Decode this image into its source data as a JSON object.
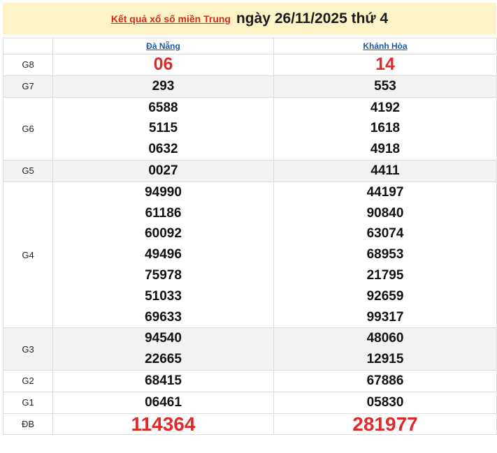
{
  "header": {
    "link_text": "Kết quả xổ số miền Trung",
    "date_text": "ngày 26/11/2025 thứ 4"
  },
  "provinces": [
    "Đà Nẵng",
    "Khánh Hòa"
  ],
  "rows": [
    {
      "label": "G8",
      "style": "red",
      "shade": "white",
      "values": [
        [
          "06"
        ],
        [
          "14"
        ]
      ]
    },
    {
      "label": "G7",
      "style": "",
      "shade": "alt",
      "values": [
        [
          "293"
        ],
        [
          "553"
        ]
      ]
    },
    {
      "label": "G6",
      "style": "",
      "shade": "white",
      "values": [
        [
          "6588",
          "5115",
          "0632"
        ],
        [
          "4192",
          "1618",
          "4918"
        ]
      ]
    },
    {
      "label": "G5",
      "style": "",
      "shade": "alt",
      "values": [
        [
          "0027"
        ],
        [
          "4411"
        ]
      ]
    },
    {
      "label": "G4",
      "style": "",
      "shade": "white",
      "values": [
        [
          "94990",
          "61186",
          "60092",
          "49496",
          "75978",
          "51033",
          "69633"
        ],
        [
          "44197",
          "90840",
          "63074",
          "68953",
          "21795",
          "92659",
          "99317"
        ]
      ]
    },
    {
      "label": "G3",
      "style": "",
      "shade": "alt",
      "values": [
        [
          "94540",
          "22665"
        ],
        [
          "48060",
          "12915"
        ]
      ]
    },
    {
      "label": "G2",
      "style": "",
      "shade": "white",
      "values": [
        [
          "68415"
        ],
        [
          "67886"
        ]
      ]
    },
    {
      "label": "G1",
      "style": "",
      "shade": "white",
      "values": [
        [
          "06461"
        ],
        [
          "05830"
        ]
      ]
    },
    {
      "label": "ĐB",
      "style": "big",
      "shade": "white",
      "values": [
        [
          "114364"
        ],
        [
          "281977"
        ]
      ]
    }
  ],
  "colors": {
    "header_bg": "#fdf3c7",
    "accent_red": "#d42a1e",
    "province_link": "#1c5aa8"
  }
}
